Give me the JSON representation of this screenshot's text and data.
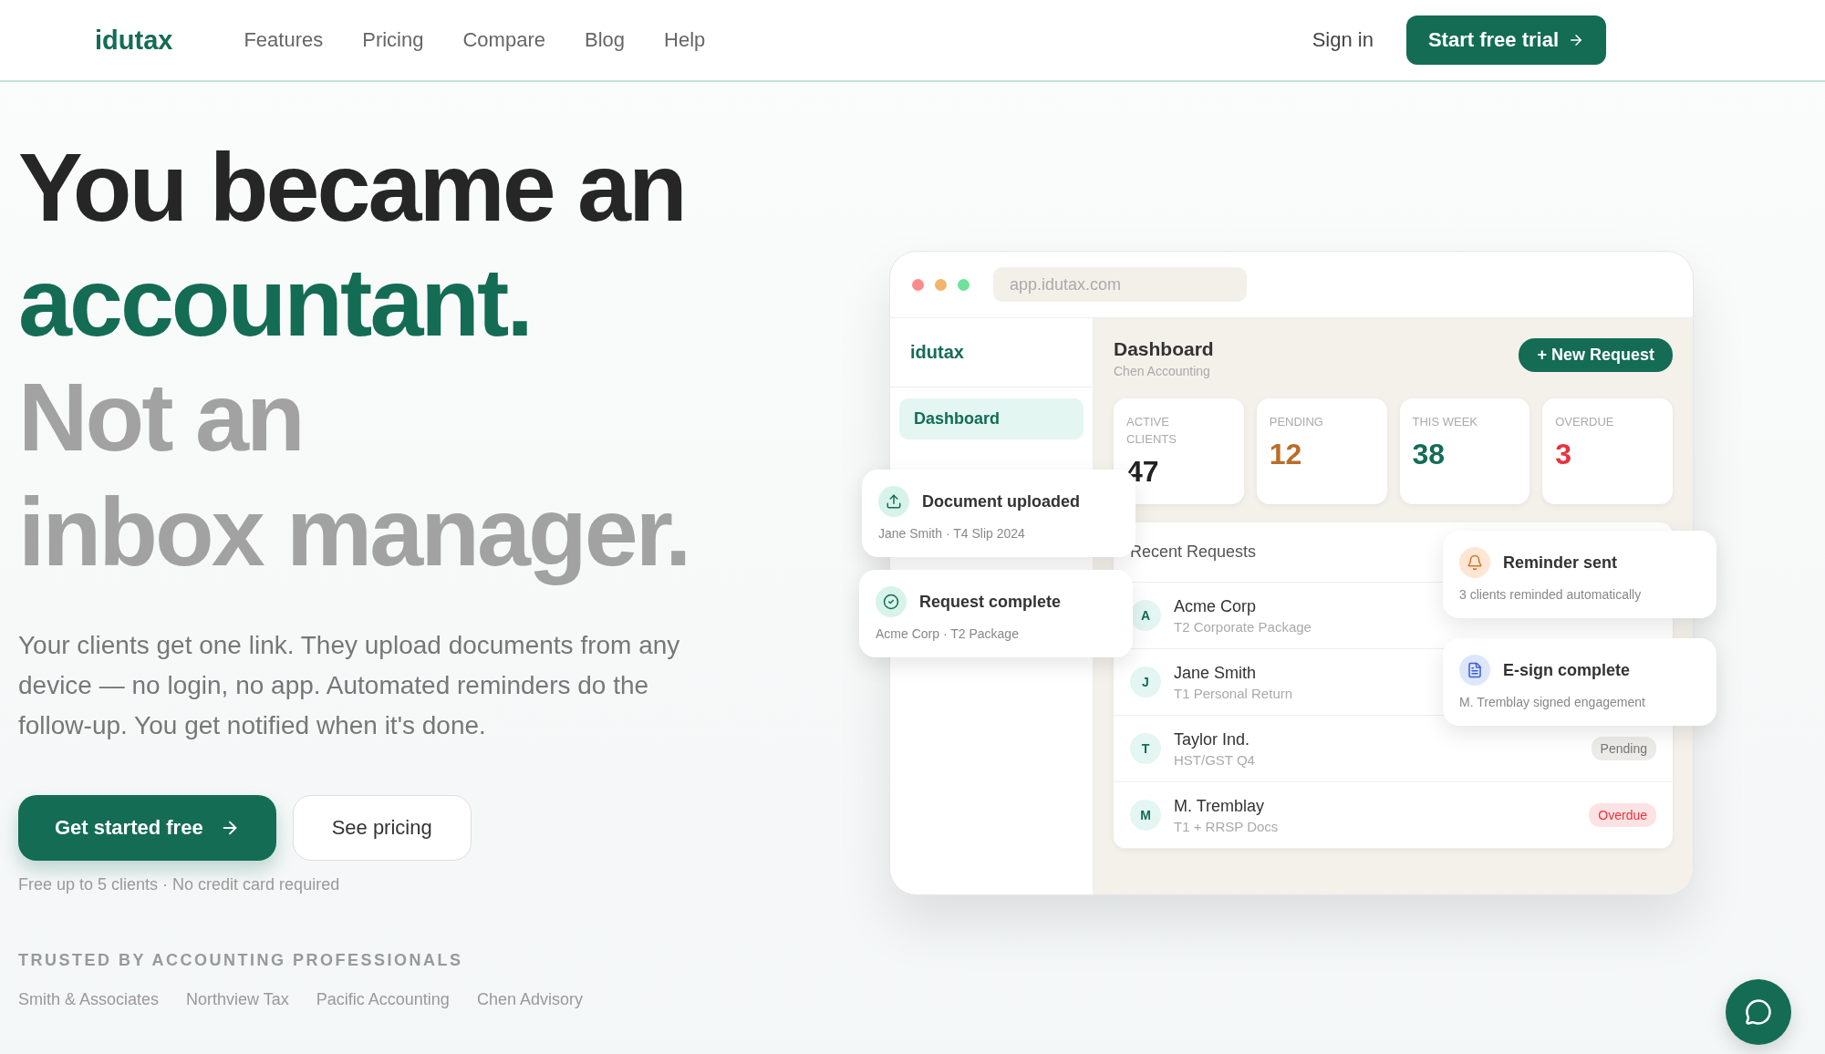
{
  "header": {
    "logo": "idutax",
    "nav": [
      "Features",
      "Pricing",
      "Compare",
      "Blog",
      "Help"
    ],
    "sign_in": "Sign in",
    "cta": "Start free trial"
  },
  "hero": {
    "headline": [
      {
        "text": "You became an",
        "kind": "dark"
      },
      {
        "text": "accountant.",
        "kind": "accent"
      },
      {
        "text": "Not an",
        "kind": "muted"
      },
      {
        "text": "inbox manager.",
        "kind": "muted"
      }
    ],
    "description": "Your clients get one link. They upload documents from any device — no login, no app. Automated reminders do the follow-up. You get notified when it's done.",
    "primary_button": "Get started free",
    "secondary_button": "See pricing",
    "note": "Free up to 5 clients · No credit card required",
    "trusted_label": "TRUSTED BY ACCOUNTING PROFESSIONALS",
    "trusted_logos": [
      "Smith & Associates",
      "Northview Tax",
      "Pacific Accounting",
      "Chen Advisory"
    ]
  },
  "mockup": {
    "url": "app.idutax.com",
    "sidebar": {
      "logo": "idutax",
      "items": [
        {
          "label": "Dashboard",
          "selected": true
        }
      ]
    },
    "title": "Dashboard",
    "subtitle": "Chen Accounting",
    "new_request": "+ New Request",
    "stats": [
      {
        "label": "ACTIVE CLIENTS",
        "value": "47",
        "color": "#222222"
      },
      {
        "label": "PENDING",
        "value": "12",
        "color": "#b86e2a"
      },
      {
        "label": "THIS WEEK",
        "value": "38",
        "color": "#146c54"
      },
      {
        "label": "OVERDUE",
        "value": "3",
        "color": "#e8323c"
      }
    ],
    "recent_title": "Recent Requests",
    "requests": [
      {
        "initial": "A",
        "name": "Acme Corp",
        "detail": "T2 Corporate Package"
      },
      {
        "initial": "J",
        "name": "Jane Smith",
        "detail": "T1 Personal Return"
      },
      {
        "initial": "T",
        "name": "Taylor Ind.",
        "detail": "HST/GST Q4",
        "status": {
          "label": "Pending",
          "kind": "pending"
        }
      },
      {
        "initial": "M",
        "name": "M. Tremblay",
        "detail": "T1 + RRSP Docs",
        "status": {
          "label": "Overdue",
          "kind": "overdue"
        }
      }
    ]
  },
  "toasts": [
    {
      "kind": "upload",
      "title": "Document uploaded",
      "detail": "Jane Smith · T4 Slip 2024"
    },
    {
      "kind": "complete",
      "title": "Request complete",
      "detail": "Acme Corp · T2 Package"
    },
    {
      "kind": "reminder",
      "title": "Reminder sent",
      "detail": "3 clients reminded automatically"
    },
    {
      "kind": "esign",
      "title": "E-sign complete",
      "detail": "M. Tremblay signed engagement"
    }
  ]
}
